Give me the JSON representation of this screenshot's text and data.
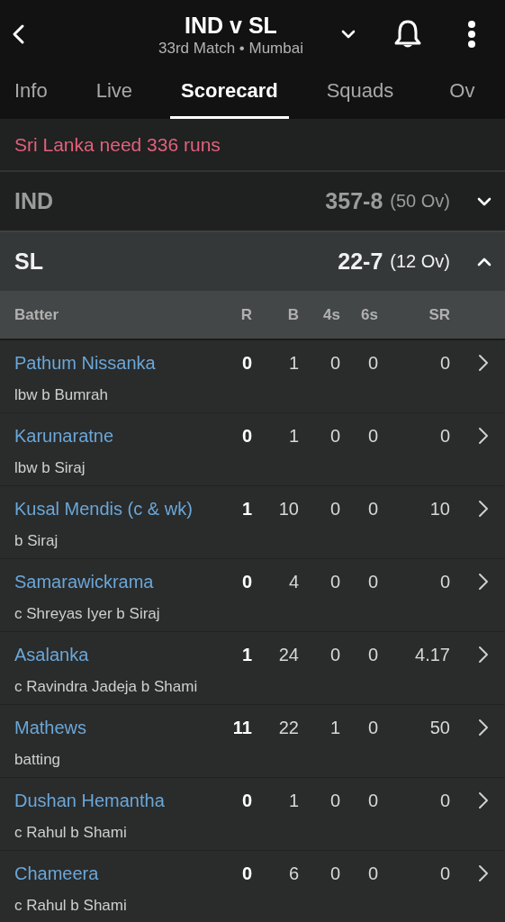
{
  "header": {
    "title": "IND v SL",
    "subtitle": "33rd Match • Mumbai"
  },
  "tabs": [
    {
      "label": "Info",
      "selected": false
    },
    {
      "label": "Live",
      "selected": false
    },
    {
      "label": "Scorecard",
      "selected": true
    },
    {
      "label": "Squads",
      "selected": false
    },
    {
      "label": "Ov",
      "selected": false
    }
  ],
  "status": "Sri Lanka need 336 runs",
  "innings": [
    {
      "team": "IND",
      "score": "357-8",
      "overs": "(50 Ov)",
      "expanded": false
    },
    {
      "team": "SL",
      "score": "22-7",
      "overs": "(12 Ov)",
      "expanded": true
    }
  ],
  "table": {
    "columns": [
      "Batter",
      "R",
      "B",
      "4s",
      "6s",
      "SR"
    ],
    "rows": [
      {
        "name": "Pathum Nissanka",
        "dismissal": "lbw b Bumrah",
        "r": "0",
        "b": "1",
        "fours": "0",
        "sixes": "0",
        "sr": "0"
      },
      {
        "name": "Karunaratne",
        "dismissal": "lbw b Siraj",
        "r": "0",
        "b": "1",
        "fours": "0",
        "sixes": "0",
        "sr": "0"
      },
      {
        "name": "Kusal Mendis (c & wk)",
        "dismissal": "b Siraj",
        "r": "1",
        "b": "10",
        "fours": "0",
        "sixes": "0",
        "sr": "10"
      },
      {
        "name": "Samarawickrama",
        "dismissal": "c Shreyas Iyer b Siraj",
        "r": "0",
        "b": "4",
        "fours": "0",
        "sixes": "0",
        "sr": "0"
      },
      {
        "name": "Asalanka",
        "dismissal": "c Ravindra Jadeja b Shami",
        "r": "1",
        "b": "24",
        "fours": "0",
        "sixes": "0",
        "sr": "4.17"
      },
      {
        "name": "Mathews",
        "dismissal": "batting",
        "r": "11",
        "b": "22",
        "fours": "1",
        "sixes": "0",
        "sr": "50"
      },
      {
        "name": "Dushan Hemantha",
        "dismissal": "c Rahul b Shami",
        "r": "0",
        "b": "1",
        "fours": "0",
        "sixes": "0",
        "sr": "0"
      },
      {
        "name": "Chameera",
        "dismissal": "c Rahul b Shami",
        "r": "0",
        "b": "6",
        "fours": "0",
        "sixes": "0",
        "sr": "0"
      }
    ]
  }
}
